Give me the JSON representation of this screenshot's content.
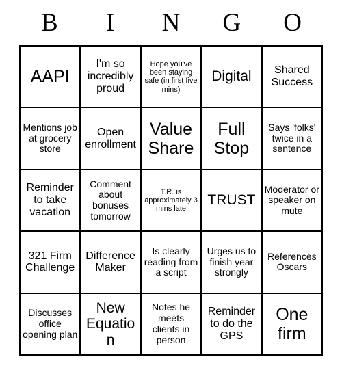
{
  "header": {
    "letters": [
      "B",
      "I",
      "N",
      "G",
      "O"
    ]
  },
  "grid": {
    "rows": 5,
    "columns": 5,
    "cells": [
      [
        {
          "text": "AAPI",
          "size": "xl"
        },
        {
          "text": "I'm so incredibly proud",
          "size": "md"
        },
        {
          "text": "Hope you've been staying safe (in first five mins)",
          "size": "xs"
        },
        {
          "text": "Digital",
          "size": "lg"
        },
        {
          "text": "Shared Success",
          "size": "md"
        }
      ],
      [
        {
          "text": "Mentions job at grocery store",
          "size": "sm"
        },
        {
          "text": "Open enrollment",
          "size": "md"
        },
        {
          "text": "Value Share",
          "size": "xl"
        },
        {
          "text": "Full Stop",
          "size": "xl"
        },
        {
          "text": "Says 'folks' twice in a sentence",
          "size": "sm"
        }
      ],
      [
        {
          "text": "Reminder to take vacation",
          "size": "md"
        },
        {
          "text": "Comment about bonuses tomorrow",
          "size": "sm"
        },
        {
          "text": "T.R. is approximately 3 mins late",
          "size": "xs"
        },
        {
          "text": "TRUST",
          "size": "lg"
        },
        {
          "text": "Moderator or speaker on mute",
          "size": "sm"
        }
      ],
      [
        {
          "text": "321 Firm Challenge",
          "size": "md"
        },
        {
          "text": "Difference Maker",
          "size": "md"
        },
        {
          "text": "Is clearly reading from a script",
          "size": "sm"
        },
        {
          "text": "Urges us to finish year strongly",
          "size": "sm"
        },
        {
          "text": "References Oscars",
          "size": "sm"
        }
      ],
      [
        {
          "text": "Discusses office opening plan",
          "size": "sm"
        },
        {
          "text": "New Equation",
          "size": "lg"
        },
        {
          "text": "Notes he meets clients in person",
          "size": "sm"
        },
        {
          "text": "Reminder to do the GPS",
          "size": "md"
        },
        {
          "text": "One firm",
          "size": "xl"
        }
      ]
    ]
  },
  "colors": {
    "border": "#000000",
    "background": "#ffffff",
    "text": "#000000"
  }
}
